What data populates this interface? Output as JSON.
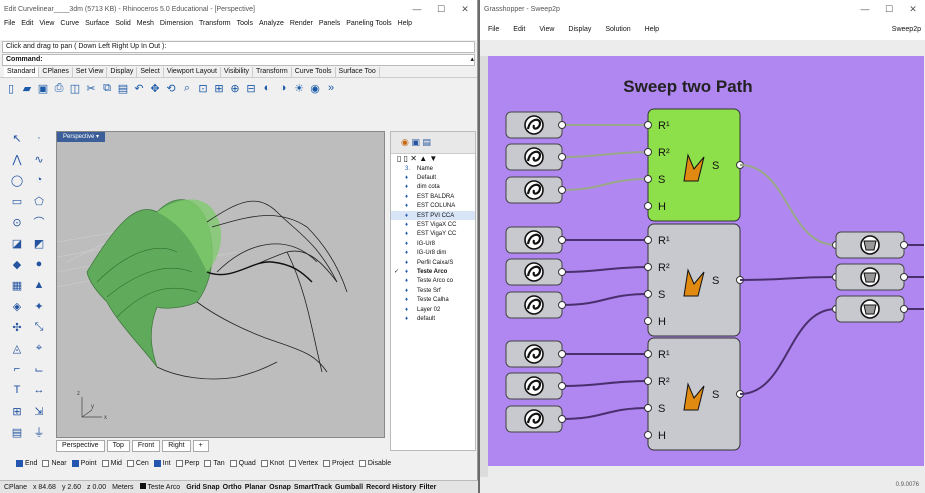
{
  "rhino": {
    "title": "Edit Curvelinear____3dm (5713 KB) - Rhinoceros 5.0 Educational - [Perspective]",
    "menu": [
      "File",
      "Edit",
      "View",
      "Curve",
      "Surface",
      "Solid",
      "Mesh",
      "Dimension",
      "Transform",
      "Tools",
      "Analyze",
      "Render",
      "Panels",
      "Paneling Tools",
      "Help"
    ],
    "command_history": "Click and drag to pan ( Down  Left  Right  Up  In  Out ):",
    "command_label": "Command:",
    "toolbar_tabs": [
      "Standard",
      "CPlanes",
      "Set View",
      "Display",
      "Select",
      "Viewport Layout",
      "Visibility",
      "Transform",
      "Curve Tools",
      "Surface Too"
    ],
    "viewport_title": "Perspective",
    "viewport_tabs": [
      "Perspective",
      "Top",
      "Front",
      "Right",
      "+"
    ],
    "layers": [
      {
        "name": "Name",
        "type": "header"
      },
      {
        "name": "Default"
      },
      {
        "name": "dim cota"
      },
      {
        "name": "EST BALDRA"
      },
      {
        "name": "EST COLUNA"
      },
      {
        "name": "EST PVI CCA",
        "selected": true
      },
      {
        "name": "EST VigaX CC"
      },
      {
        "name": "EST VigaY CC"
      },
      {
        "name": "IG-Ur8"
      },
      {
        "name": "IG-Ur8 dim"
      },
      {
        "name": "Perfil Caixa/S"
      },
      {
        "name": "Teste Arco",
        "current": true,
        "bold": true
      },
      {
        "name": "Teste Arco co"
      },
      {
        "name": "Teste Srf"
      },
      {
        "name": "Teste Calha"
      },
      {
        "name": "Layer 02"
      },
      {
        "name": "default"
      }
    ],
    "osnap": [
      {
        "label": "End",
        "on": true
      },
      {
        "label": "Near",
        "on": false
      },
      {
        "label": "Point",
        "on": true
      },
      {
        "label": "Mid",
        "on": false
      },
      {
        "label": "Cen",
        "on": false
      },
      {
        "label": "Int",
        "on": true
      },
      {
        "label": "Perp",
        "on": false
      },
      {
        "label": "Tan",
        "on": false
      },
      {
        "label": "Quad",
        "on": false
      },
      {
        "label": "Knot",
        "on": false
      },
      {
        "label": "Vertex",
        "on": false
      },
      {
        "label": "Project",
        "on": false
      },
      {
        "label": "Disable",
        "on": false
      }
    ],
    "status": {
      "cplane": "CPlane",
      "x": "x 84.68",
      "y": "y 2.60",
      "z": "z 0.00",
      "units": "Meters",
      "layer": "Teste Arco",
      "toggles": [
        "Grid Snap",
        "Ortho",
        "Planar",
        "Osnap",
        "SmartTrack",
        "Gumball",
        "Record History",
        "Filter"
      ]
    }
  },
  "gh": {
    "title": "Grasshopper - Sweep2p",
    "menu": [
      "File",
      "Edit",
      "View",
      "Display",
      "Solution",
      "Help"
    ],
    "menu_right": "Sweep2p",
    "canvas_title": "Sweep two Path",
    "sweep_inputs": [
      "R¹",
      "R²",
      "S",
      "H"
    ],
    "sweep_output": "S",
    "version": "0.9.0076",
    "colors": {
      "canvas": "#b087f0",
      "selected": "#8ee04a",
      "node": "#c8c8cf",
      "wire_dark": "#4a2f6e",
      "wire_light": "#9aa88a"
    }
  }
}
